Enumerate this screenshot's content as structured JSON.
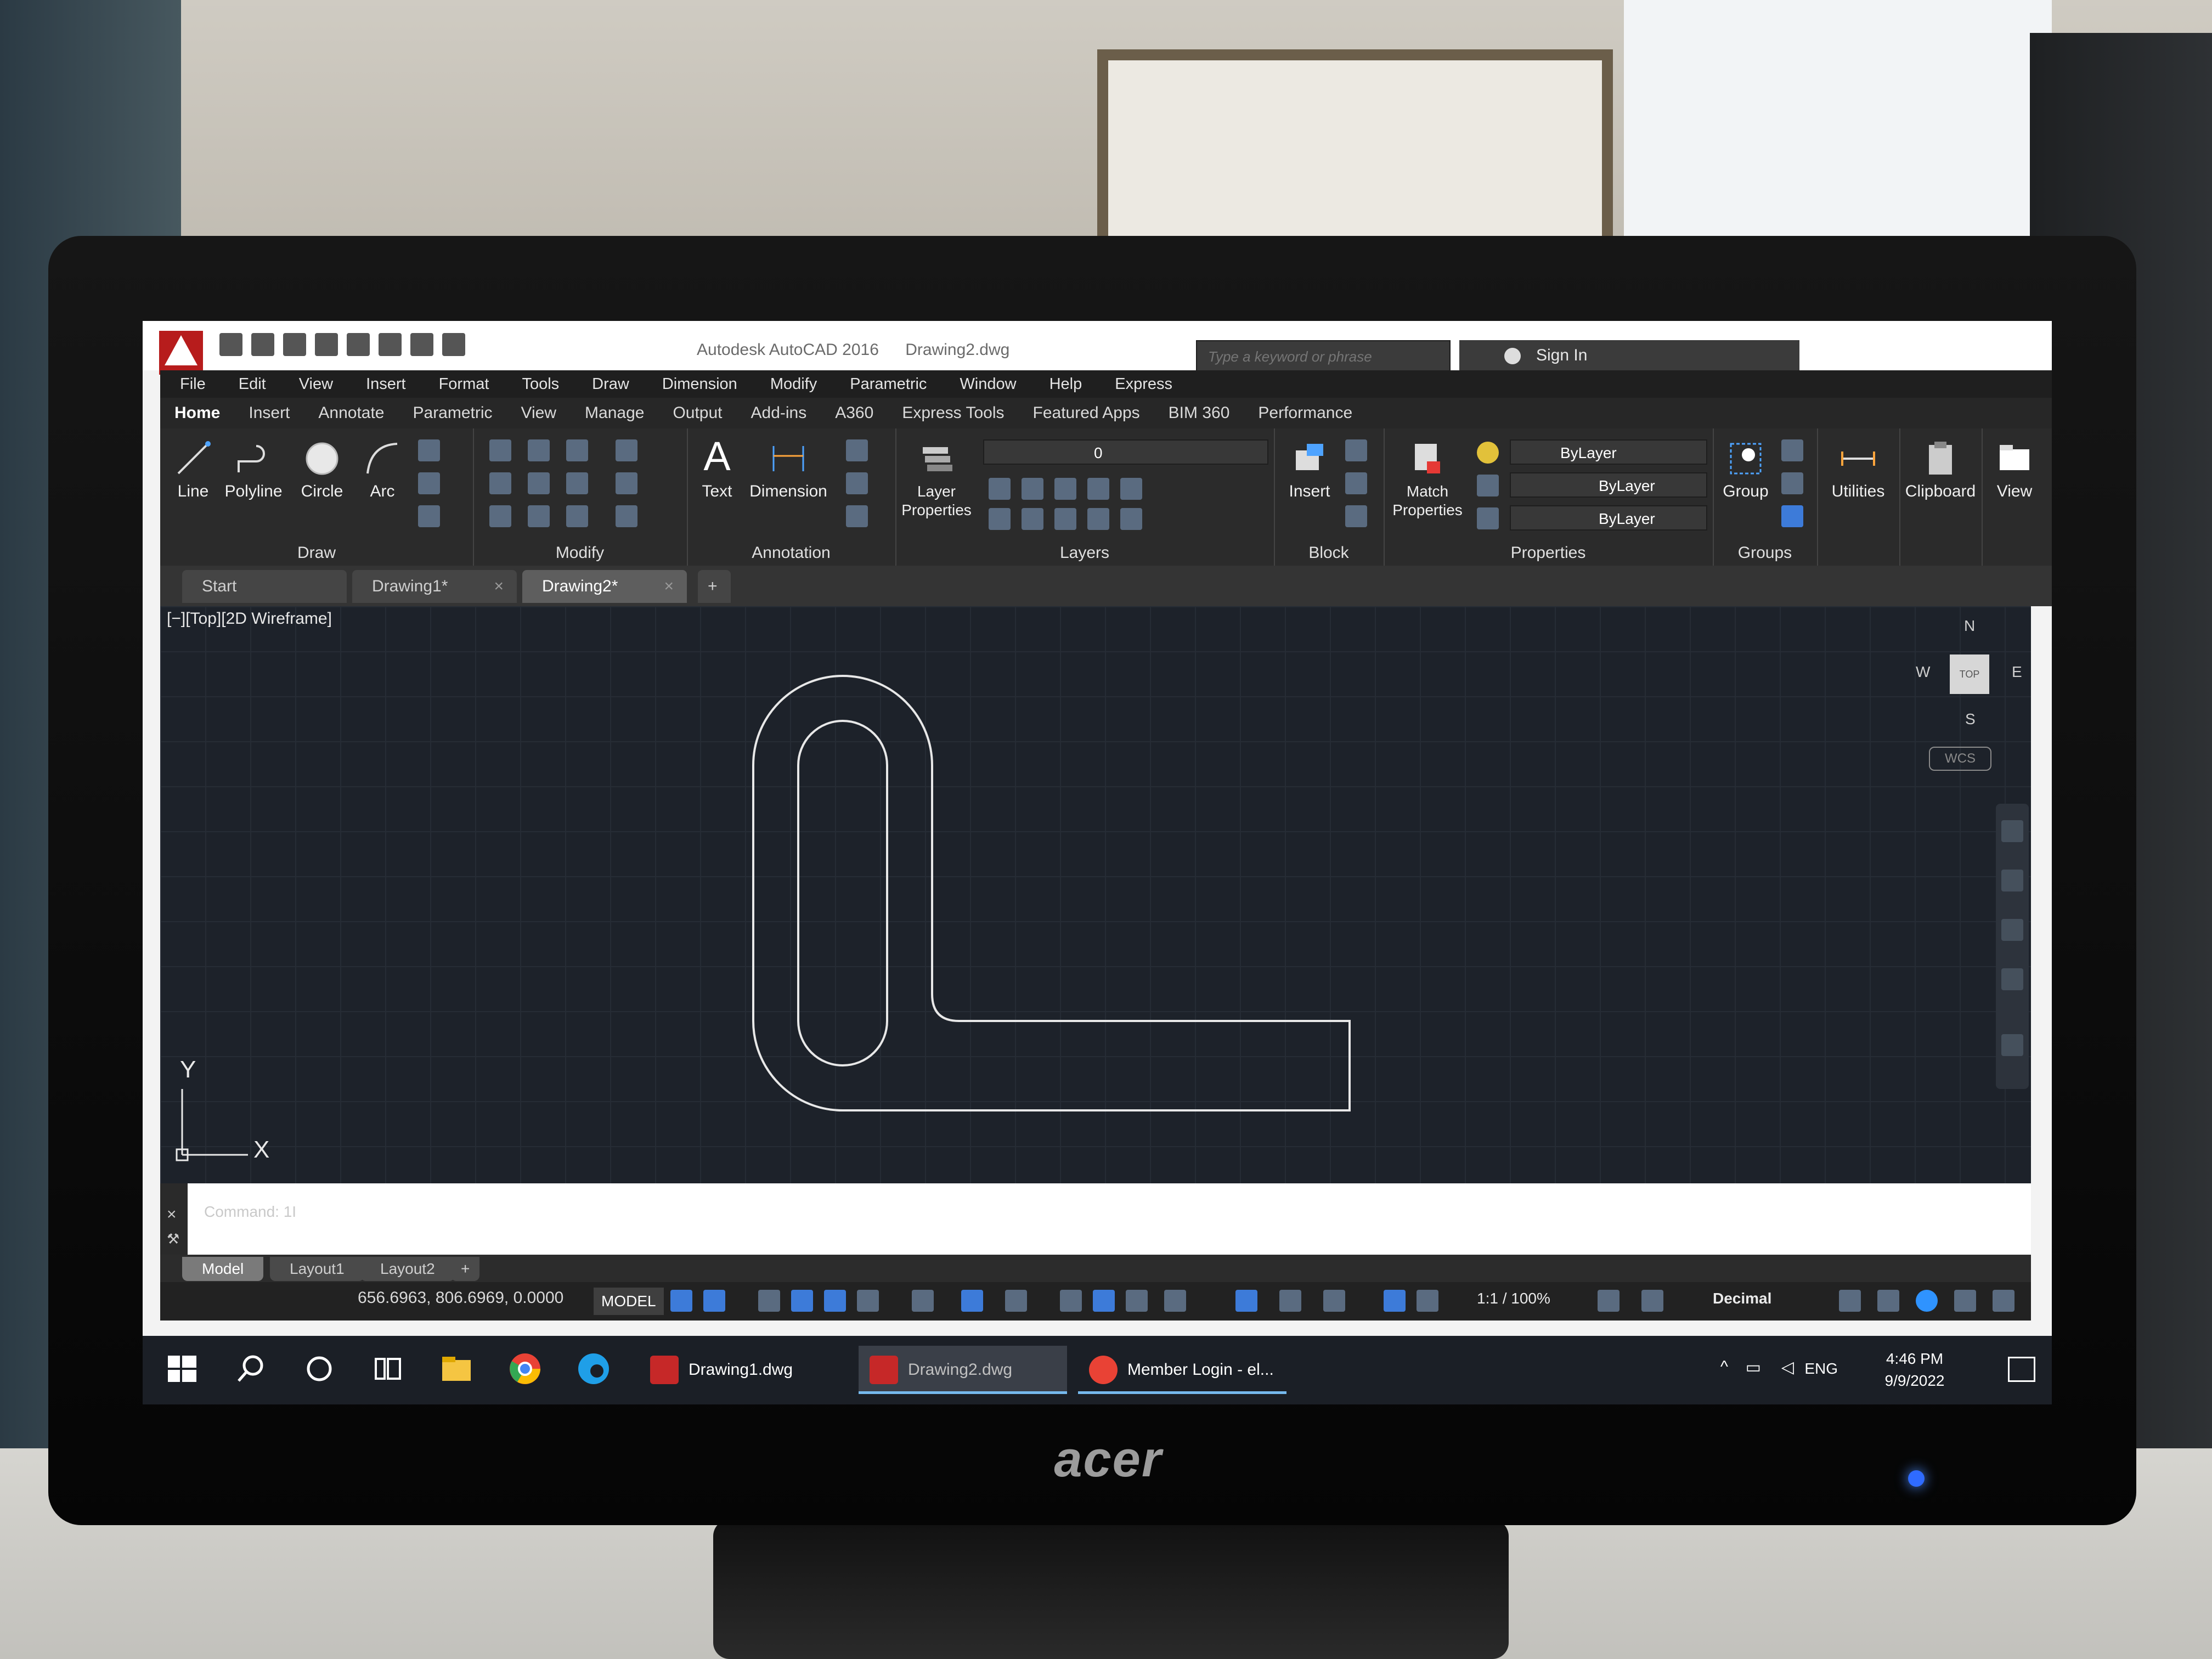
{
  "window": {
    "title_app": "Autodesk AutoCAD 2016",
    "title_file": "Drawing2.dwg",
    "search_placeholder": "Type a keyword or phrase",
    "sign_in": "Sign In"
  },
  "menu": [
    "File",
    "Edit",
    "View",
    "Insert",
    "Format",
    "Tools",
    "Draw",
    "Dimension",
    "Modify",
    "Parametric",
    "Window",
    "Help",
    "Express"
  ],
  "ribbon_tabs": [
    "Home",
    "Insert",
    "Annotate",
    "Parametric",
    "View",
    "Manage",
    "Output",
    "Add-ins",
    "A360",
    "Express Tools",
    "Featured Apps",
    "BIM 360",
    "Performance"
  ],
  "ribbon": {
    "draw": {
      "title": "Draw",
      "line": "Line",
      "polyline": "Polyline",
      "circle": "Circle",
      "arc": "Arc"
    },
    "modify": {
      "title": "Modify"
    },
    "annotation": {
      "title": "Annotation",
      "text": "Text",
      "dimension": "Dimension"
    },
    "layers": {
      "title": "Layers",
      "layer_properties_1": "Layer",
      "layer_properties_2": "Properties",
      "current_layer": "0"
    },
    "block": {
      "title": "Block",
      "insert": "Insert"
    },
    "properties": {
      "title": "Properties",
      "match_1": "Match",
      "match_2": "Properties",
      "color": "ByLayer",
      "linetype": "ByLayer",
      "lineweight": "ByLayer"
    },
    "groups": {
      "title": "Groups",
      "group": "Group"
    },
    "utilities": "Utilities",
    "clipboard": "Clipboard",
    "view": "View"
  },
  "doc_tabs": [
    "Start",
    "Drawing1*",
    "Drawing2*"
  ],
  "viewport_label": "[−][Top][2D Wireframe]",
  "viewcube": {
    "n": "N",
    "s": "S",
    "e": "E",
    "w": "W",
    "top": "TOP",
    "wcs": "WCS"
  },
  "ucs": {
    "x": "X",
    "y": "Y"
  },
  "command_line": "Command: 1I",
  "layout_tabs": [
    "Model",
    "Layout1",
    "Layout2"
  ],
  "status": {
    "coordinates": "656.6963, 806.6969, 0.0000",
    "model": "MODEL",
    "scale": "1:1 / 100%",
    "units": "Decimal"
  },
  "taskbar": {
    "apps": [
      "Drawing1.dwg",
      "Drawing2.dwg",
      "Member Login - el..."
    ],
    "lang": "ENG",
    "time": "4:46 PM",
    "date": "9/9/2022"
  },
  "monitor_brand": "acer"
}
